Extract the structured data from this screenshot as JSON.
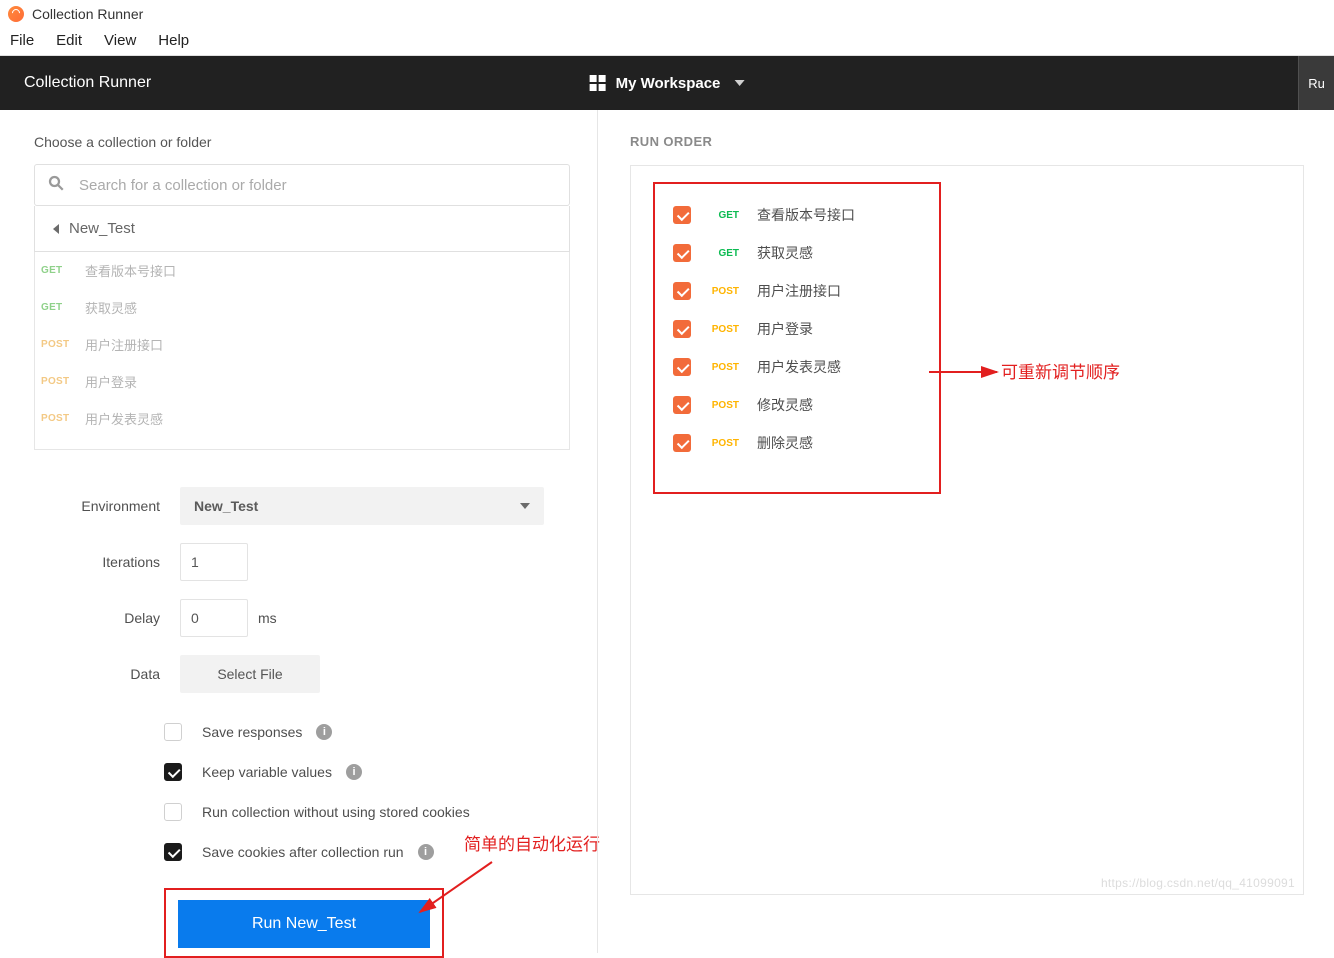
{
  "titlebar": {
    "title": "Collection Runner"
  },
  "menu": {
    "file": "File",
    "edit": "Edit",
    "view": "View",
    "help": "Help"
  },
  "darkheader": {
    "title": "Collection Runner",
    "workspace": "My Workspace",
    "rightbtn": "Ru"
  },
  "left": {
    "choose_label": "Choose a collection or folder",
    "search_placeholder": "Search for a collection or folder",
    "collection_name": "New_Test",
    "requests": [
      {
        "method": "GET",
        "cls": "m-get",
        "name": "查看版本号接口"
      },
      {
        "method": "GET",
        "cls": "m-get",
        "name": "获取灵感"
      },
      {
        "method": "POST",
        "cls": "m-post",
        "name": "用户注册接口"
      },
      {
        "method": "POST",
        "cls": "m-post",
        "name": "用户登录"
      },
      {
        "method": "POST",
        "cls": "m-post",
        "name": "用户发表灵感"
      }
    ],
    "environment_label": "Environment",
    "environment_value": "New_Test",
    "iterations_label": "Iterations",
    "iterations_value": "1",
    "delay_label": "Delay",
    "delay_value": "0",
    "delay_unit": "ms",
    "data_label": "Data",
    "select_file": "Select File",
    "opt_save_resp": "Save responses",
    "opt_keep_vars": "Keep variable values",
    "opt_no_cookies": "Run collection without using stored cookies",
    "opt_save_cookies": "Save cookies after collection run",
    "run_button": "Run New_Test",
    "annot1": "简单的自动化运行"
  },
  "right": {
    "title": "RUN ORDER",
    "items": [
      {
        "method": "GET",
        "cls": "rm-get",
        "name": "查看版本号接口"
      },
      {
        "method": "GET",
        "cls": "rm-get",
        "name": "获取灵感"
      },
      {
        "method": "POST",
        "cls": "rm-post",
        "name": "用户注册接口"
      },
      {
        "method": "POST",
        "cls": "rm-post",
        "name": "用户登录"
      },
      {
        "method": "POST",
        "cls": "rm-post",
        "name": "用户发表灵感"
      },
      {
        "method": "POST",
        "cls": "rm-post",
        "name": "修改灵感"
      },
      {
        "method": "POST",
        "cls": "rm-post",
        "name": "删除灵感"
      }
    ],
    "annot2": "可重新调节顺序",
    "watermark": "https://blog.csdn.net/qq_41099091"
  }
}
